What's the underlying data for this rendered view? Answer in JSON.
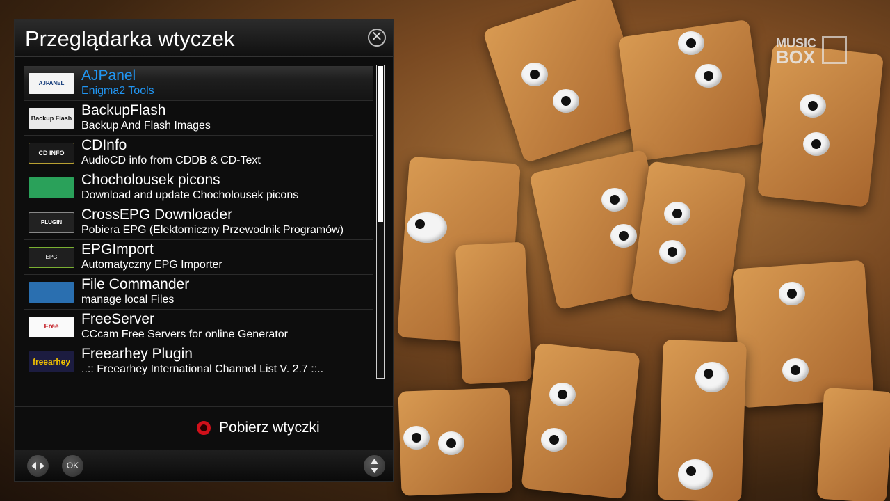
{
  "window": {
    "title": "Przeglądarka wtyczek",
    "close_symbol": "✕"
  },
  "plugins": [
    {
      "name": "AJPanel",
      "desc": "Enigma2 Tools",
      "icon": "ajpanel-icon",
      "icon_text": "AJPANEL",
      "selected": true
    },
    {
      "name": "BackupFlash",
      "desc": "Backup And Flash Images",
      "icon": "backupflash-icon",
      "icon_text": "Backup Flash"
    },
    {
      "name": "CDInfo",
      "desc": "AudioCD info from CDDB & CD-Text",
      "icon": "cdinfo-icon",
      "icon_text": "CD INFO"
    },
    {
      "name": "Chocholousek picons",
      "desc": "Download and update Chocholousek picons",
      "icon": "picons-tv-icon",
      "icon_text": ""
    },
    {
      "name": "CrossEPG Downloader",
      "desc": "Pobiera EPG (Elektorniczny Przewodnik Programów)",
      "icon": "crossepg-icon",
      "icon_text": "PLUGIN"
    },
    {
      "name": "EPGImport",
      "desc": "Automatyczny EPG Importer",
      "icon": "epgimport-icon",
      "icon_text": "EPG"
    },
    {
      "name": "File Commander",
      "desc": "manage local Files",
      "icon": "file-commander-icon",
      "icon_text": ""
    },
    {
      "name": "FreeServer",
      "desc": "CCcam Free Servers for online Generator",
      "icon": "freeserver-icon",
      "icon_text": "Free"
    },
    {
      "name": "Freearhey Plugin",
      "desc": "..:: Freearhey International Channel List V. 2.7 ::..",
      "icon": "freearhey-icon",
      "icon_text": "freearhey"
    }
  ],
  "scroll_fraction_visible": 0.5,
  "action": {
    "label": "Pobierz wtyczki",
    "color": "#d0101a"
  },
  "footer": {
    "ok_label": "OK"
  },
  "overlay": {
    "channel_logo_line1": "MUSIC",
    "channel_logo_line2": "BOX"
  },
  "colors": {
    "selected_text": "#2196f3",
    "window_bg": "#0d0d0d"
  }
}
